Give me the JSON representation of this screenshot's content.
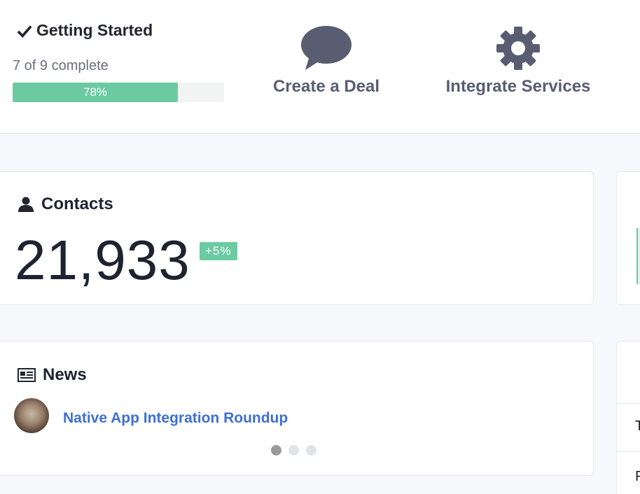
{
  "getting_started": {
    "title": "Getting Started",
    "progress_text": "7 of 9 complete",
    "progress_fraction": 0.78,
    "progress_label": "78%"
  },
  "actions": {
    "create_deal": {
      "label": "Create a Deal",
      "icon": "speech-bubble-icon"
    },
    "integrate": {
      "label": "Integrate Services",
      "icon": "gear-icon"
    }
  },
  "contacts": {
    "title": "Contacts",
    "icon": "person-icon",
    "count": "21,933",
    "change": "+5%"
  },
  "news": {
    "title": "News",
    "icon": "newspaper-icon",
    "items": [
      {
        "title": "Native App Integration Roundup"
      }
    ],
    "dots_total": 3,
    "active_dot": 0
  },
  "right_column": {
    "row_initials": [
      "T",
      "F"
    ]
  },
  "colors": {
    "accent_green": "#6ccaa2",
    "link_blue": "#3d6fd6",
    "icon_slate": "#585d72"
  }
}
